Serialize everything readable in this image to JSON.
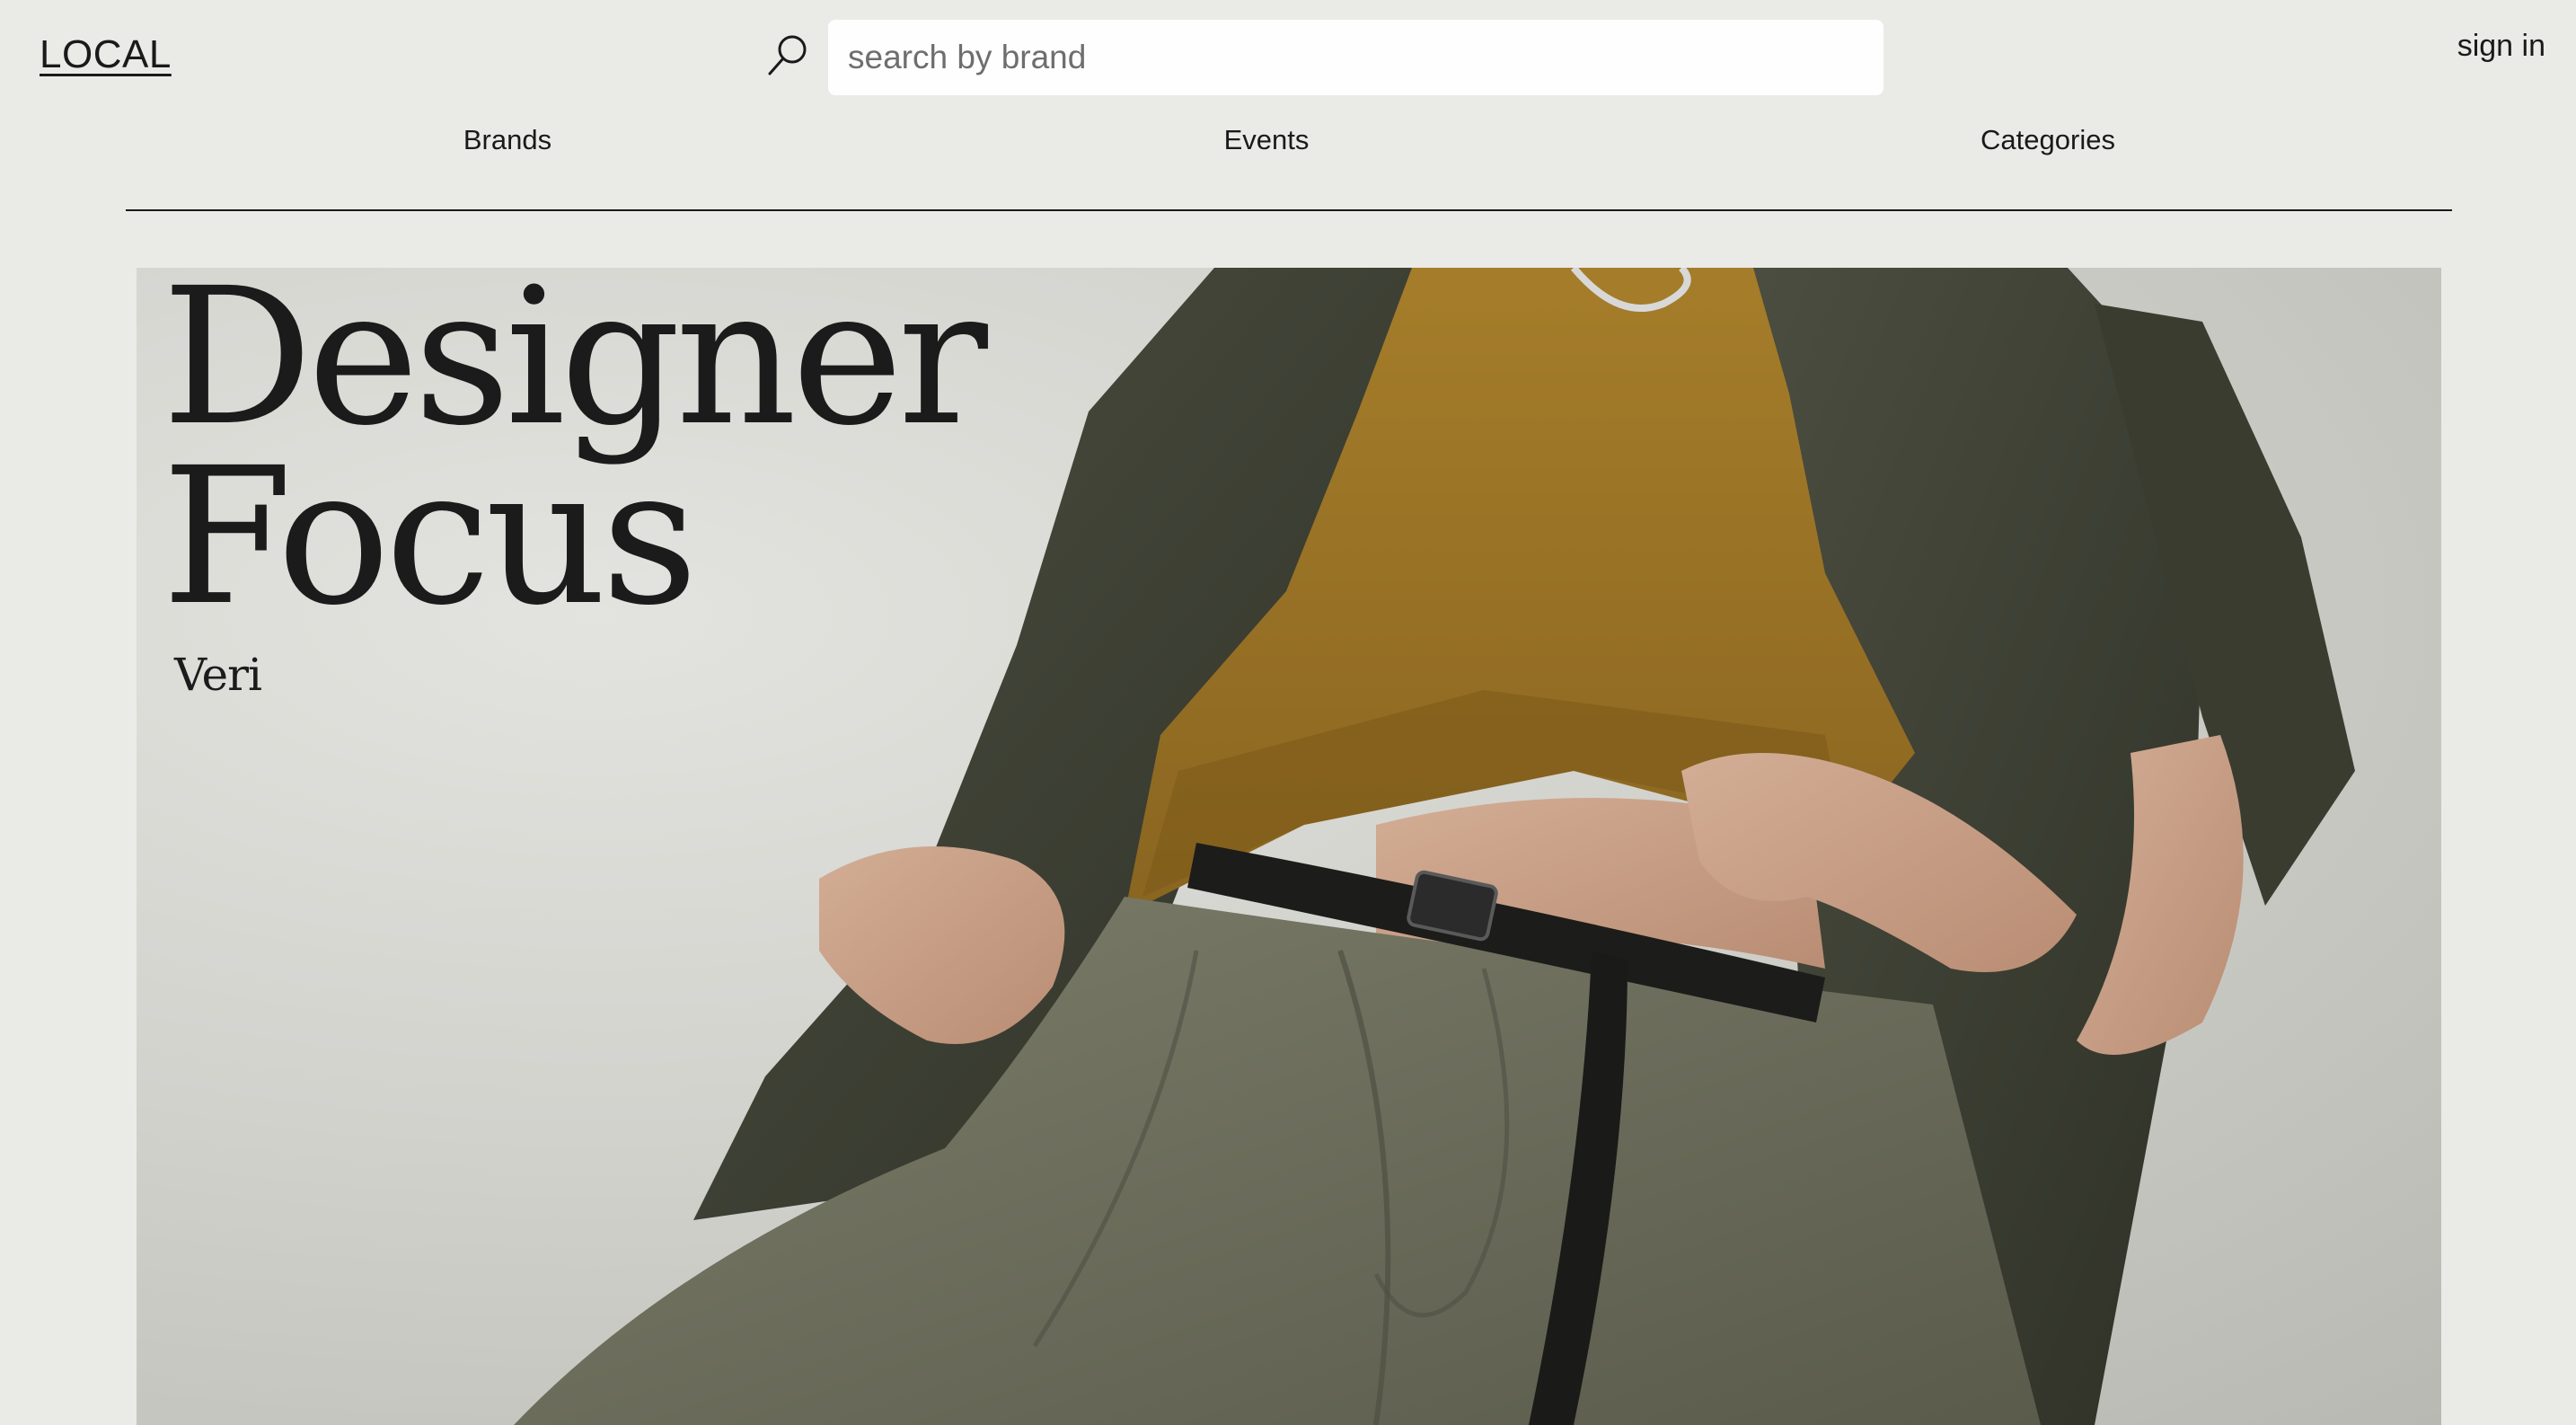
{
  "header": {
    "logo": "LOCAL",
    "search": {
      "placeholder": "search by brand",
      "value": ""
    },
    "sign_in": "sign in"
  },
  "nav": {
    "items": [
      {
        "label": "Brands"
      },
      {
        "label": "Events"
      },
      {
        "label": "Categories"
      }
    ]
  },
  "hero": {
    "title": "Designer\nFocus",
    "subtitle": "Veri"
  },
  "icons": {
    "search": "search-icon"
  },
  "colors": {
    "background": "#eaebe7",
    "text": "#161616",
    "search_box": "#fefefe"
  }
}
